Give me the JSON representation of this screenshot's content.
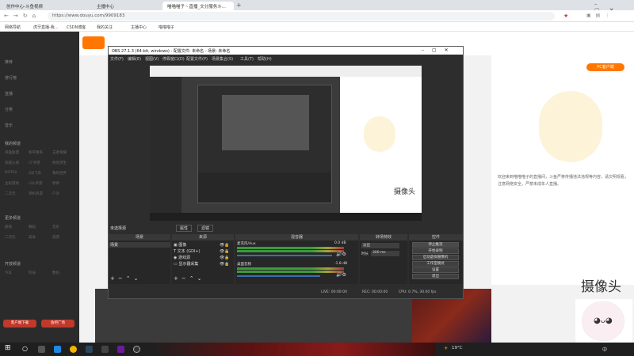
{
  "browser": {
    "tabs": [
      {
        "label": "创作中心-斗鱼视频"
      },
      {
        "label": "主播中心"
      },
      {
        "label": "喵喵喵子丶直播_文分服务斗..."
      }
    ],
    "url": "https://www.douyu.com/9909183",
    "bookmarks": [
      "网络导航",
      "虎牙直播-我...",
      "CSDN博客",
      "我的关注",
      "主播中心",
      "喵喵喵子"
    ]
  },
  "sidebar": {
    "items": [
      "推荐",
      "排行榜",
      "直播",
      "分类",
      "音乐"
    ],
    "section1_title": "我的频道",
    "grid1": [
      "英雄联盟",
      "和平精英",
      "王者荣耀",
      "穿越火线",
      "CF手游",
      "绝地求生",
      "DOTA2",
      "QQ飞车",
      "我的世界",
      "主机游戏",
      "LOL手游",
      "原神",
      "二次元",
      "单机热游",
      "户外"
    ],
    "section2_title": "更多频道",
    "grid2": [
      "颜值",
      "舞蹈",
      "音乐",
      "二次元",
      "美食",
      "旅游"
    ],
    "section3_title": "开放频道",
    "grid3": [
      "汽车",
      "科技",
      "数码"
    ],
    "bottom_buttons": [
      "客户端下载",
      "鱼吧广场"
    ]
  },
  "page": {
    "pc_client": "PC客户端",
    "chat_notice": "欢迎来到喵喵喵子的直播间，斗鱼严禁传播违法违规等内容，请文明观看，注意网络安全，严禁未成年人直播。",
    "cam_label": "摄像头"
  },
  "obs": {
    "title": "OBS 27.1.3 (64-bit, windows) - 配置文件: 未命名 - 场景: 未命名",
    "menu": [
      "文件(F)",
      "编辑(E)",
      "视图(V)",
      "停靠窗口(D)",
      "配置文件(P)",
      "场景集合(S)",
      "工具(T)",
      "帮助(H)"
    ],
    "no_source": "未选择源",
    "properties_btn": "属性",
    "filters_btn": "滤镜",
    "docks": {
      "scenes": "场景",
      "sources": "来源",
      "mixer": "混音器",
      "transitions": "转场特效",
      "controls": "控件"
    },
    "scene_item": "场景",
    "sources": [
      "图像",
      "文本 (GDI+)",
      "游戏源",
      "显示器采集"
    ],
    "mixer": [
      {
        "name": "麦克风/Aux",
        "db": "0.0 dB"
      },
      {
        "name": "桌面音频",
        "db": "-1.8 dB"
      }
    ],
    "transition": {
      "type": "淡出",
      "duration_label": "时长",
      "duration": "300 ms"
    },
    "controls": [
      "停止推流",
      "开始录制",
      "启动虚拟摄像机",
      "工作室模式",
      "设置",
      "退出"
    ],
    "status": {
      "live": "LIVE: 00:00:00",
      "rec": "REC: 00:00:00",
      "cpu": "CPU: 0.7%, 30.00 fps"
    }
  },
  "taskbar": {
    "weather": "19°C",
    "time": "",
    "lang": "中"
  },
  "colors": {
    "accent_blue": "#3d6db0",
    "douyu_orange": "#ff7700",
    "obs_bg": "#2d2d2d"
  }
}
